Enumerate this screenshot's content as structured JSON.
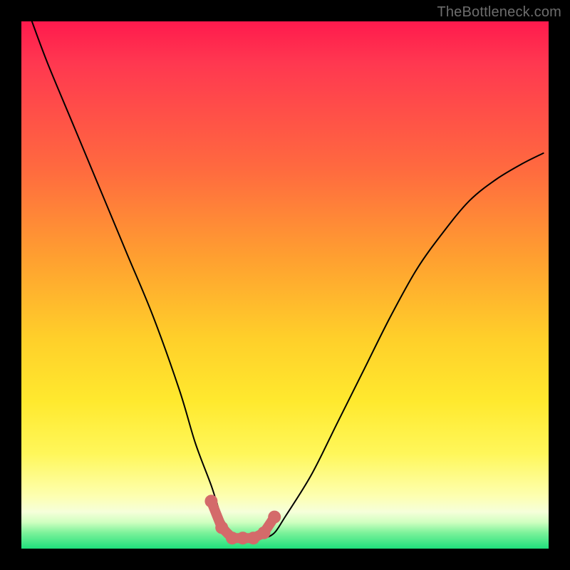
{
  "watermark": {
    "text": "TheBottleneck.com"
  },
  "chart_data": {
    "type": "line",
    "title": "",
    "xlabel": "",
    "ylabel": "",
    "xlim": [
      0,
      100
    ],
    "ylim": [
      0,
      100
    ],
    "series": [
      {
        "name": "bottleneck-curve",
        "x": [
          2,
          5,
          10,
          15,
          20,
          25,
          30,
          33,
          36,
          38,
          40,
          42,
          44,
          46,
          48,
          50,
          55,
          60,
          65,
          70,
          75,
          80,
          85,
          90,
          95,
          99
        ],
        "values": [
          100,
          92,
          80,
          68,
          56,
          44,
          30,
          20,
          12,
          6,
          3,
          2,
          2,
          2,
          3,
          6,
          14,
          24,
          34,
          44,
          53,
          60,
          66,
          70,
          73,
          75
        ]
      },
      {
        "name": "flat-bottom-highlight",
        "x": [
          36,
          38,
          40,
          42,
          44,
          46,
          48
        ],
        "values": [
          9,
          4,
          2,
          2,
          2,
          3,
          6
        ]
      }
    ],
    "colors": {
      "curve": "#000000",
      "highlight": "#d46a6a",
      "gradient_top": "#ff1a4d",
      "gradient_mid": "#ffe92e",
      "gradient_bottom": "#1fe07c"
    }
  }
}
